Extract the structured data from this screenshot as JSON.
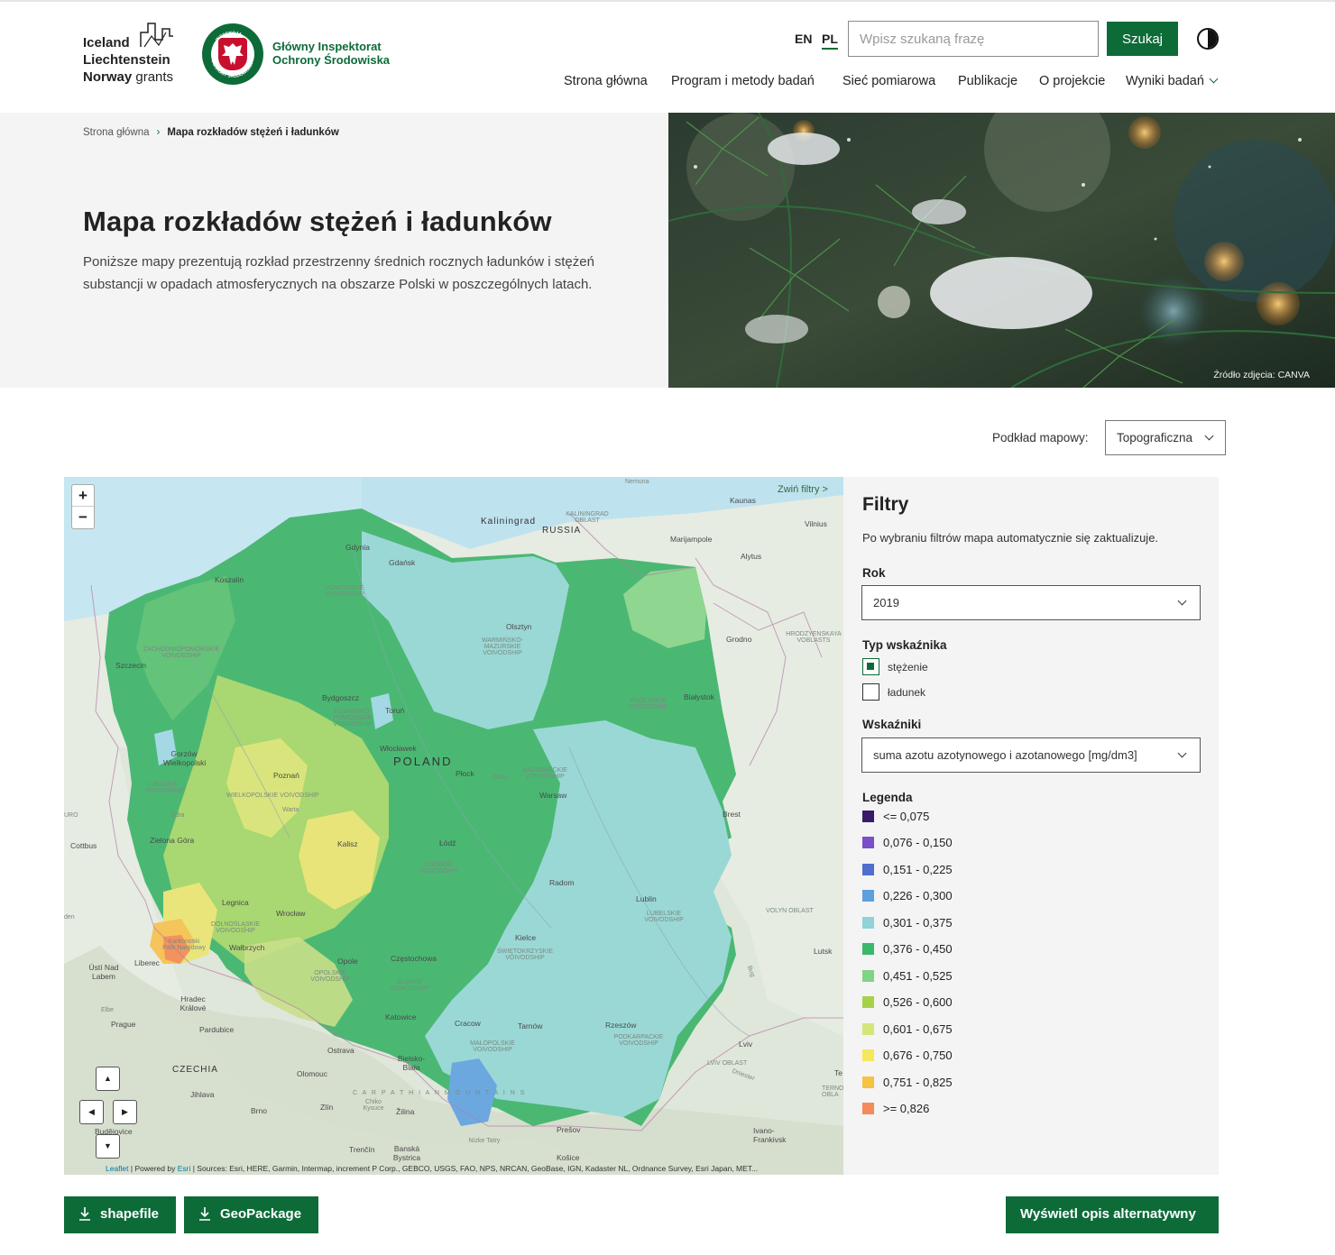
{
  "header": {
    "grants_logo": {
      "line1": "Iceland",
      "line2": "Liechtenstein",
      "line3_bold": "Norway",
      "line3_light": "grants"
    },
    "gios_logo": {
      "line1": "Główny Inspektorat",
      "line2": "Ochrony Środowiska",
      "emblem_text_top": "INSPEKCJA",
      "emblem_text_bottom": "OCHRONY ŚRODOWISKA"
    },
    "languages": [
      {
        "label": "EN"
      },
      {
        "label": "PL",
        "active": true
      }
    ],
    "search": {
      "placeholder": "Wpisz szukaną frazę",
      "button": "Szukaj"
    },
    "contrast_icon": "contrast-icon",
    "nav": [
      "Strona główna",
      "Program i metody badań",
      "Sieć pomiarowa",
      "Publikacje",
      "O projekcie",
      "Wyniki badań"
    ]
  },
  "hero": {
    "breadcrumb": {
      "home": "Strona główna",
      "current": "Mapa rozkładów stężeń i ładunków"
    },
    "title": "Mapa rozkładów stężeń i ładunków",
    "description": "Poniższe mapy prezentują rozkład przestrzenny średnich rocznych ładunków i stężeń substancji w opadach atmosferycznych na obszarze Polski w poszczególnych latach.",
    "photo_credit": "Źródło zdjęcia: CANVA"
  },
  "basemap": {
    "label": "Podkład mapowy:",
    "value": "Topograficzna"
  },
  "map": {
    "zoom_in": "+",
    "zoom_out": "−",
    "collapse_filters": "Zwiń filtry >",
    "attribution": {
      "leaflet": "Leaflet",
      "powered": " | Powered by ",
      "esri": "Esri",
      "sources": " | Sources: Esri, HERE, Garmin, Intermap, increment P Corp., GEBCO, USGS, FAO, NPS, NRCAN, GeoBase, IGN, Kadaster NL, Ordnance Survey, Esri Japan, MET..."
    },
    "labels": {
      "kaliningrad": "Kaliningrad",
      "russia": "RUSSIA",
      "kaliningrad_oblast": "KALININGRAD OBLAST",
      "kaunas": "Kaunas",
      "vilnius": "Vilnius",
      "marijampole": "Marijampole",
      "alytus": "Alytus",
      "gdynia": "Gdynia",
      "gdansk": "Gdańsk",
      "koszalin": "Koszalin",
      "olsztyn": "Olsztyn",
      "grodno": "Grodno",
      "szczecin": "Szczecin",
      "bydgoszcz": "Bydgoszcz",
      "torun": "Toruń",
      "bialystok": "Białystok",
      "gorzow": "Gorzów Wielkopolski",
      "poznan": "Poznań",
      "wloclawek": "Włocławek",
      "poland": "POLAND",
      "plock": "Płock",
      "warsaw": "Warsaw",
      "brest": "Brest",
      "zielona_gora": "Zielona Góra",
      "kalisz": "Kalisz",
      "lodz": "Łódź",
      "cottbus": "Cottbus",
      "radom": "Radom",
      "legnica": "Legnica",
      "wroclaw": "Wrocław",
      "lublin": "Lublin",
      "walbrzych": "Wałbrzych",
      "opole": "Opole",
      "kielce": "Kielce",
      "czestochowa": "Częstochowa",
      "liberec": "Liberec",
      "usti": "Ústí Nad Labem",
      "lutsk": "Lutsk",
      "hradec": "Hradec Králové",
      "katowice": "Katowice",
      "krakow": "Cracow",
      "tarnow": "Tarnów",
      "rzeszow": "Rzeszów",
      "prague": "Prague",
      "pardubice": "Pardubice",
      "ostrava": "Ostrava",
      "lviv": "Lviv",
      "czechia": "CZECHIA",
      "olomouc": "Olomouc",
      "bielsko": "Bielsko-Biała",
      "jihlava": "Jihlava",
      "zlin": "Zlín",
      "zilina": "Žilina",
      "brno": "Brno",
      "presov": "Prešov",
      "ivano": "Ivano-Frankivsk",
      "trencin": "Trenčín",
      "banska": "Banská Bystrica",
      "kosice": "Košice",
      "budejovice": "Budějovice",
      "carpathian": "C A R P A T H I A N   M O U N T A I N S",
      "volyn": "VOLYN OBLAST",
      "lviv_oblast": "LVIV OBLAST",
      "hrodzyenskaya": "HRODZYENSKAYA VOBLASTS",
      "nemuna": "Nemuna",
      "dniester": "Dniester",
      "elbe": "Elbe",
      "bug": "Bug",
      "warta": "Warta",
      "odra": "Odra",
      "wisla": "Wisla",
      "tatry": "Nízke Tatry",
      "chiko": "Chiko Kysuce",
      "karkonoski": "Karkonoski Park Narodowy",
      "tarnopol": "TERNO OBLA",
      "te": "Te",
      "ro": "URO",
      "den": "den",
      "zachodniopomorskie": "ZACHODNIOPOMORSKIE VOIVODSHIP",
      "pomorskie": "POMORSKIE VOIVODSHIP",
      "warminsko": "WARMIŃSKO-MAZURSKIE VOIVODSHIP",
      "kujawsko": "KUJAWSKO-POMORSKIE VOIVODSHIP",
      "podlaskie": "PODLASKIE VOIVODSHIP",
      "lubuskie": "LUBUSKIE VOIVODSHIP",
      "wielkopolskie": "WIELKOPOLSKIE VOIVODSHIP",
      "mazowieckie": "MAZOWIECKIE VOIVODSHIP",
      "lodzkie": "ŁÓDZKIE VOIVODSHIP",
      "dolnoslaskie": "DOLNOŚLĄSKIE VOIVODSHIP",
      "lubelskie": "LUBELSKIE VOIVODSHIP",
      "opolskie": "OPOLSKIE VOIVODSHIP",
      "swietokrzyskie": "ŚWIĘTOKRZYSKIE VOIVODSHIP",
      "slaskie": "ŚLĄSKIE VOIVODSHIP",
      "malopolskie": "MAŁOPOLSKIE VOIVODSHIP",
      "podkarpackie": "PODKARPACKIE VOIVODSHIP"
    }
  },
  "filters": {
    "title": "Filtry",
    "note": "Po wybraniu filtrów mapa automatycznie się zaktualizuje.",
    "year_label": "Rok",
    "year_value": "2019",
    "type_label": "Typ wskaźnika",
    "types": [
      {
        "label": "stężenie",
        "checked": true
      },
      {
        "label": "ładunek",
        "checked": false
      }
    ],
    "indicator_label": "Wskaźniki",
    "indicator_value": "suma azotu azotynowego i azotanowego [mg/dm3]",
    "legend_title": "Legenda",
    "legend": [
      {
        "label": "<= 0,075",
        "color": "#3b1a6b"
      },
      {
        "label": "0,076 - 0,150",
        "color": "#7a4fc9"
      },
      {
        "label": "0,151 - 0,225",
        "color": "#4f6fcf"
      },
      {
        "label": "0,226 - 0,300",
        "color": "#5b9fde"
      },
      {
        "label": "0,301 - 0,375",
        "color": "#8fd3d8"
      },
      {
        "label": "0,376 - 0,450",
        "color": "#3cb86a"
      },
      {
        "label": "0,451 - 0,525",
        "color": "#7fd486"
      },
      {
        "label": "0,526 - 0,600",
        "color": "#a6d24a"
      },
      {
        "label": "0,601 - 0,675",
        "color": "#d6e57a"
      },
      {
        "label": "0,676 - 0,750",
        "color": "#f5e85a"
      },
      {
        "label": "0,751 - 0,825",
        "color": "#f5c242"
      },
      {
        "label": ">= 0,826",
        "color": "#f58a5a"
      }
    ]
  },
  "actions": {
    "shapefile": "shapefile",
    "geopackage": "GeoPackage",
    "alt_description": "Wyświetl opis alternatywny"
  },
  "colors": {
    "brand_green": "#0d6b38"
  }
}
